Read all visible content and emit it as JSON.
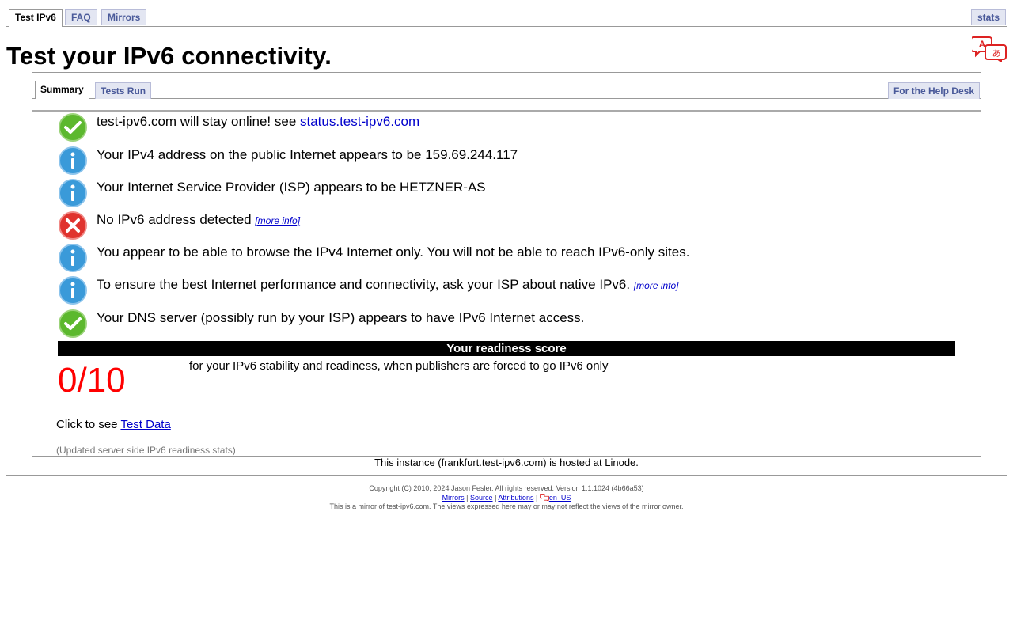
{
  "top_tabs": {
    "test": "Test IPv6",
    "faq": "FAQ",
    "mirrors": "Mirrors",
    "stats": "stats"
  },
  "page_title": "Test your IPv6 connectivity.",
  "sub_tabs": {
    "summary": "Summary",
    "tests_run": "Tests Run",
    "help_desk": "For the Help Desk"
  },
  "results": [
    {
      "status": "ok",
      "icon": "check-icon",
      "text": "test-ipv6.com will stay online! see ",
      "link": "status.test-ipv6.com"
    },
    {
      "status": "info",
      "icon": "info-icon",
      "text": "Your IPv4 address on the public Internet appears to be 159.69.244.117"
    },
    {
      "status": "info",
      "icon": "info-icon",
      "text": "Your Internet Service Provider (ISP) appears to be HETZNER-AS"
    },
    {
      "status": "error",
      "icon": "error-icon",
      "text": "No IPv6 address detected ",
      "more": "[more info]"
    },
    {
      "status": "info",
      "icon": "info-icon",
      "text": "You appear to be able to browse the IPv4 Internet only. You will not be able to reach IPv6-only sites."
    },
    {
      "status": "info",
      "icon": "info-icon",
      "text": "To ensure the best Internet performance and connectivity, ask your ISP about native IPv6. ",
      "more": "[more info]"
    },
    {
      "status": "ok",
      "icon": "check-icon",
      "text": "Your DNS server (possibly run by your ISP) appears to have IPv6 Internet access."
    }
  ],
  "readiness": {
    "header": "Your readiness score",
    "score": "0/10",
    "description": "for your IPv6 stability and readiness, when publishers are forced to go IPv6 only"
  },
  "click_to_see": {
    "prefix": "Click to see ",
    "link": "Test Data"
  },
  "updated_stats": "(Updated server side IPv6 readiness stats)",
  "hosted_note": "This instance (frankfurt.test-ipv6.com) is hosted at Linode.",
  "footer": {
    "copyright": "Copyright (C) 2010, 2024 Jason Fesler. All rights reserved. Version 1.1.1024 (4b66a53)",
    "links": {
      "mirrors": "Mirrors",
      "source": "Source",
      "attributions": "Attributions",
      "locale": "en_US"
    },
    "separator": "|",
    "mirror_note": "This is a mirror of test-ipv6.com. The views expressed here may or may not reflect the views of the mirror owner."
  },
  "colors": {
    "ok": "#5cb82e",
    "info": "#3a9ad9",
    "error": "#e0332e",
    "score": "#ff0000",
    "link": "#0000cc"
  }
}
